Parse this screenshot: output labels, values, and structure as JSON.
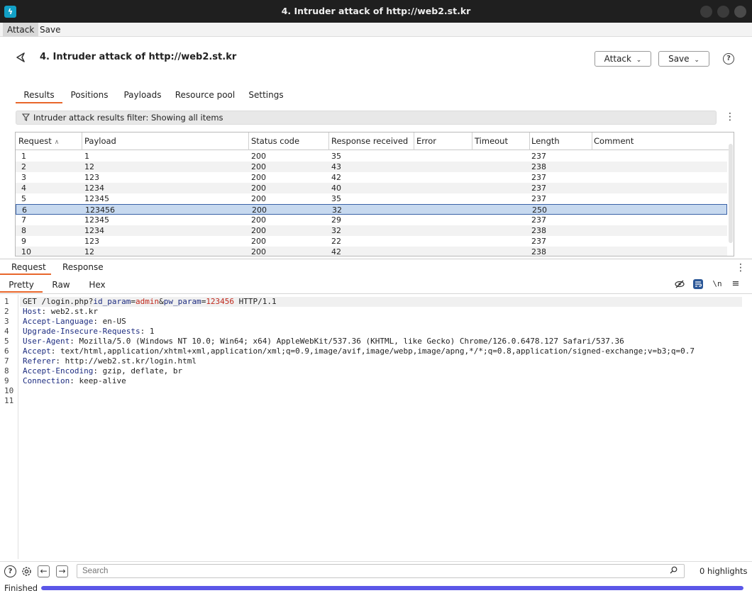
{
  "window": {
    "title": "4. Intruder attack of http://web2.st.kr"
  },
  "menu": {
    "items": [
      "Attack",
      "Save"
    ]
  },
  "header": {
    "title": "4. Intruder attack of http://web2.st.kr",
    "attack_label": "Attack",
    "save_label": "Save"
  },
  "tabs": [
    "Results",
    "Positions",
    "Payloads",
    "Resource pool",
    "Settings"
  ],
  "filter": {
    "text": "Intruder attack results filter: Showing all items"
  },
  "table": {
    "columns": [
      "Request",
      "Payload",
      "Status code",
      "Response received",
      "Error",
      "Timeout",
      "Length",
      "Comment"
    ],
    "rows": [
      {
        "request": "1",
        "payload": "1",
        "status": "200",
        "response": "35",
        "error": "",
        "timeout": "",
        "length": "237",
        "comment": ""
      },
      {
        "request": "2",
        "payload": "12",
        "status": "200",
        "response": "43",
        "error": "",
        "timeout": "",
        "length": "238",
        "comment": ""
      },
      {
        "request": "3",
        "payload": "123",
        "status": "200",
        "response": "42",
        "error": "",
        "timeout": "",
        "length": "237",
        "comment": ""
      },
      {
        "request": "4",
        "payload": "1234",
        "status": "200",
        "response": "40",
        "error": "",
        "timeout": "",
        "length": "237",
        "comment": ""
      },
      {
        "request": "5",
        "payload": "12345",
        "status": "200",
        "response": "35",
        "error": "",
        "timeout": "",
        "length": "237",
        "comment": ""
      },
      {
        "request": "6",
        "payload": "123456",
        "status": "200",
        "response": "32",
        "error": "",
        "timeout": "",
        "length": "250",
        "comment": ""
      },
      {
        "request": "7",
        "payload": "12345",
        "status": "200",
        "response": "29",
        "error": "",
        "timeout": "",
        "length": "237",
        "comment": ""
      },
      {
        "request": "8",
        "payload": "1234",
        "status": "200",
        "response": "32",
        "error": "",
        "timeout": "",
        "length": "238",
        "comment": ""
      },
      {
        "request": "9",
        "payload": "123",
        "status": "200",
        "response": "22",
        "error": "",
        "timeout": "",
        "length": "237",
        "comment": ""
      },
      {
        "request": "10",
        "payload": "12",
        "status": "200",
        "response": "42",
        "error": "",
        "timeout": "",
        "length": "238",
        "comment": ""
      }
    ],
    "selected_request": "6"
  },
  "message_tabs": [
    "Request",
    "Response"
  ],
  "view_tabs": [
    "Pretty",
    "Raw",
    "Hex"
  ],
  "editor": {
    "line_numbers": [
      "1",
      "2",
      "3",
      "4",
      "5",
      "6",
      "7",
      "8",
      "9",
      "10",
      "11"
    ],
    "request_line": {
      "method_path": "GET /login.php?",
      "p1_name": "id_param",
      "eq1": "=",
      "p1_value": "admin",
      "amp": "&",
      "p2_name": "pw_param",
      "eq2": "=",
      "p2_value": "123456",
      "protocol": " HTTP/1.1"
    },
    "headers": [
      {
        "name": "Host",
        "value": "web2.st.kr"
      },
      {
        "name": "Accept-Language",
        "value": "en-US"
      },
      {
        "name": "Upgrade-Insecure-Requests",
        "value": "1"
      },
      {
        "name": "User-Agent",
        "value": "Mozilla/5.0 (Windows NT 10.0; Win64; x64) AppleWebKit/537.36 (KHTML, like Gecko) Chrome/126.0.6478.127 Safari/537.36"
      },
      {
        "name": "Accept",
        "value": "text/html,application/xhtml+xml,application/xml;q=0.9,image/avif,image/webp,image/apng,*/*;q=0.8,application/signed-exchange;v=b3;q=0.7"
      },
      {
        "name": "Referer",
        "value": "http://web2.st.kr/login.html"
      },
      {
        "name": "Accept-Encoding",
        "value": "gzip, deflate, br"
      },
      {
        "name": "Connection",
        "value": "keep-alive"
      }
    ]
  },
  "search": {
    "placeholder": "Search",
    "highlights": "0 highlights"
  },
  "status": {
    "text": "Finished",
    "progress_percent": 100
  },
  "colors": {
    "accent": "#e8662b",
    "progress": "#5b57e8",
    "selection": "#c7d9ef"
  },
  "icons": [
    "app-logo-icon",
    "back-icon",
    "chevron-down-icon",
    "help-icon",
    "filter-icon",
    "kebab-menu-icon",
    "sort-asc-icon",
    "eye-off-icon",
    "wrap-icon",
    "newline-icon",
    "hamburger-icon",
    "settings-icon",
    "arrow-left-icon",
    "arrow-right-icon",
    "search-icon"
  ]
}
